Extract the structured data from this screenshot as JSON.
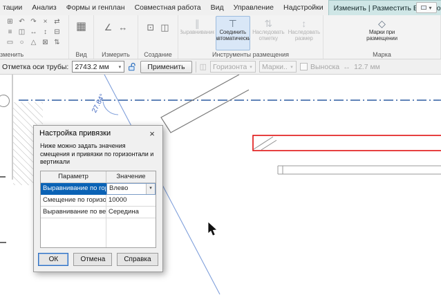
{
  "icons": {
    "dropdown": "▾",
    "close": "×"
  },
  "tab_bar": {
    "tabs": [
      "тации",
      "Анализ",
      "Формы и генплан",
      "Совместная работа",
      "Вид",
      "Управление",
      "Надстройки",
      "Изменить | Разместить Воздуховод"
    ],
    "active_tab": "Изменить | Разместить Воздуховод"
  },
  "ribbon": {
    "modify_panel": {
      "label": "зменить",
      "icons": [
        "⊞",
        "↶",
        "↷",
        "×",
        "⇄",
        "≡",
        "◫",
        "↔",
        "↕",
        "⊟",
        "▭",
        "○",
        "△",
        "⊠",
        "⇅"
      ]
    },
    "view_panel": {
      "label": "Вид",
      "icon": "▦"
    },
    "measure_panel": {
      "label": "Измерить",
      "icons": [
        "∠",
        "↔"
      ]
    },
    "create_panel": {
      "label": "Создание",
      "icons": [
        "⊡",
        "◫"
      ]
    },
    "placement_panel": {
      "label": "Инструменты размещения",
      "buttons": [
        {
          "label": "Выравнивание",
          "icon": "∥",
          "state": "disabled"
        },
        {
          "label": "Соединить автоматически",
          "icon": "⊤",
          "state": "active"
        },
        {
          "label": "Наследовать отметку",
          "icon": "⇅",
          "state": "disabled"
        },
        {
          "label": "Наследовать размер",
          "icon": "↕",
          "state": "disabled"
        }
      ]
    },
    "tag_panel": {
      "label": "Марка",
      "button": {
        "label": "Марки при размещении",
        "icon": "◇"
      }
    }
  },
  "options_bar": {
    "offset_label": "Отметка оси трубы:",
    "offset_value": "2743.2 мм",
    "apply_button": "Применить",
    "horizontal_combo": "Горизонта",
    "tags_button": "Марки...",
    "leader_checkbox_label": "Выноска",
    "leader_offset_value": "12.7 мм"
  },
  "canvas": {
    "angle_label": "27.64°"
  },
  "dialog": {
    "title": "Настройка привязки",
    "description": "Ниже можно задать значения смещения и привязки по горизонтали и вертикали",
    "table": {
      "headers": [
        "Параметр",
        "Значение"
      ],
      "rows": [
        {
          "param": "Выравнивание по гори",
          "value": "Влево"
        },
        {
          "param": "Смещение по горизон",
          "value": "10000"
        },
        {
          "param": "Выравнивание по верт",
          "value": "Середина"
        }
      ]
    },
    "buttons": [
      "ОК",
      "Отмена",
      "Справка"
    ]
  }
}
